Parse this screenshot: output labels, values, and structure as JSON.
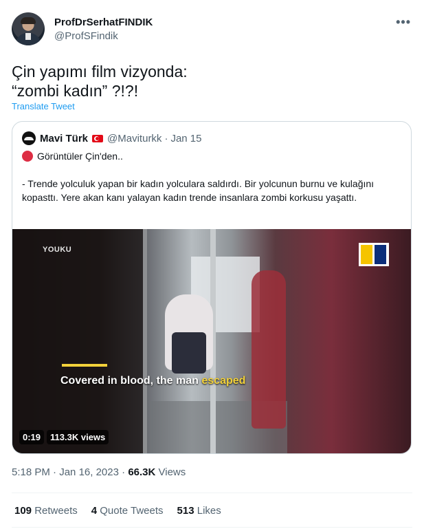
{
  "author": {
    "name": "ProfDrSerhatFINDIK",
    "handle": "@ProfSFindik"
  },
  "more_icon": "more-horizontal-icon",
  "tweet": {
    "text": "Çin yapımı film vizyonda:\n“zombi kadın” ?!?!",
    "translate_label": "Translate Tweet"
  },
  "quote": {
    "name": "Mavi Türk",
    "flag_icon": "turkey-flag-icon",
    "handle": "@Maviturkk",
    "separator": "·",
    "date": "Jan 15",
    "line1": "Görüntüler Çin'den..",
    "paragraph": "- Trende yolculuk yapan bir kadın yolculara saldırdı. Bir yolcunun burnu ve kulağını kopasttı. Yere akan kanı yalayan kadın trende insanlara zombi korkusu yaşattı.",
    "video": {
      "watermark": "YOUKU",
      "caption_main": "Covered in blood, the man ",
      "caption_highlight": "escaped",
      "duration": "0:19",
      "views": "113.3K views"
    }
  },
  "meta": {
    "time": "5:18 PM",
    "sep1": "·",
    "date": "Jan 16, 2023",
    "sep2": "·",
    "views_num": "66.3K",
    "views_label": "Views"
  },
  "stats": {
    "retweets_num": "109",
    "retweets_label": "Retweets",
    "quotes_num": "4",
    "quotes_label": "Quote Tweets",
    "likes_num": "513",
    "likes_label": "Likes"
  }
}
